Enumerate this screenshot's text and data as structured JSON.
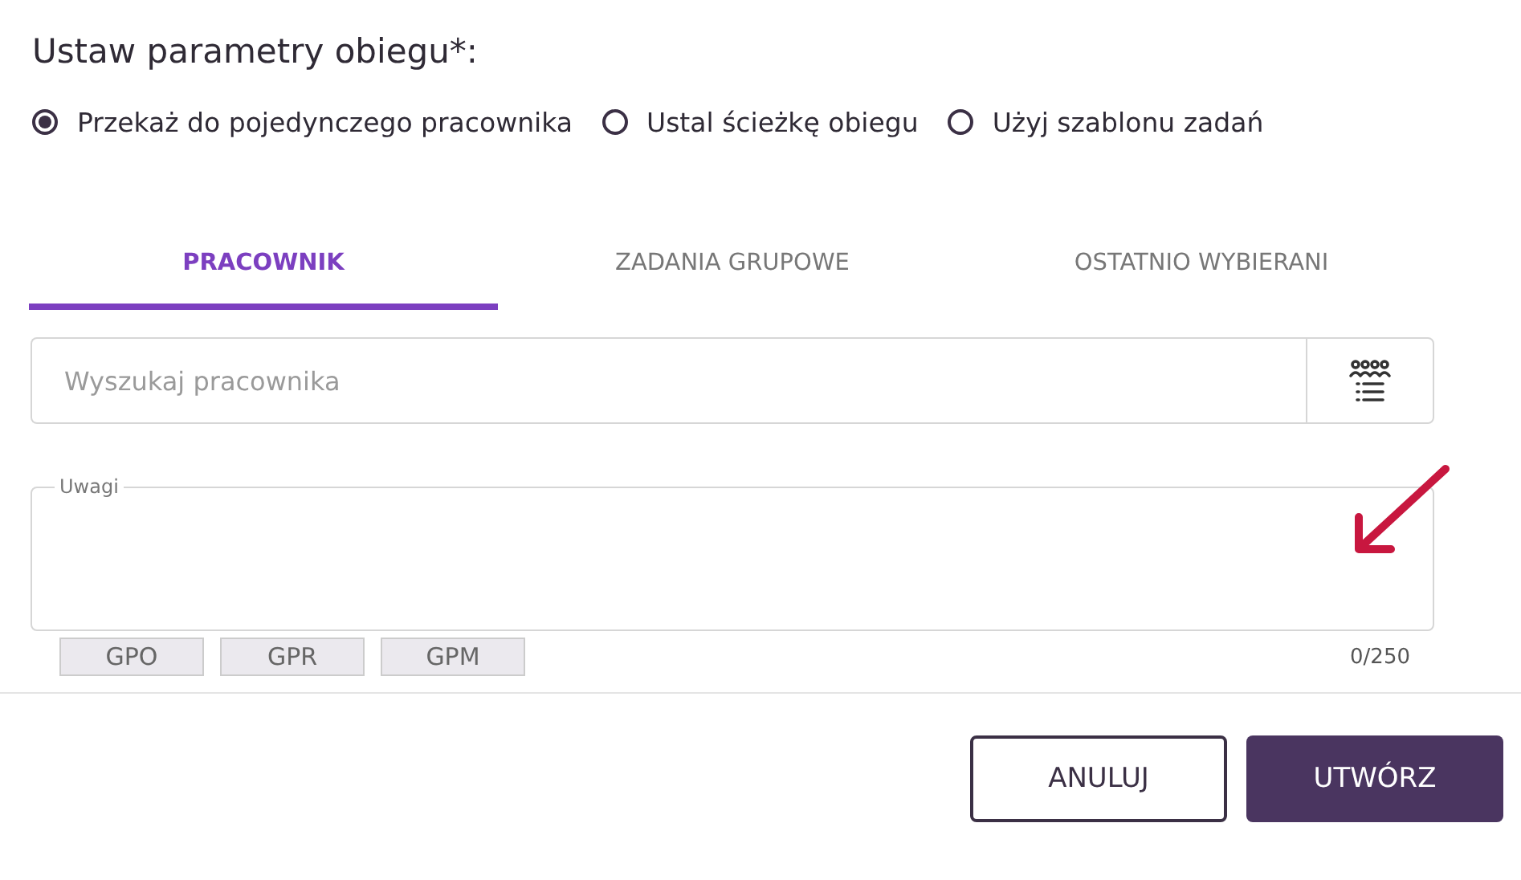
{
  "heading": "Ustaw parametry obiegu*:",
  "options": [
    {
      "label": "Przekaż do pojedynczego pracownika",
      "selected": true
    },
    {
      "label": "Ustal ścieżkę obiegu",
      "selected": false
    },
    {
      "label": "Użyj szablonu zadań",
      "selected": false
    }
  ],
  "tabs": [
    {
      "label": "PRACOWNIK",
      "selected": true
    },
    {
      "label": "ZADANIA GRUPOWE",
      "selected": false
    },
    {
      "label": "OSTATNIO WYBIERANI",
      "selected": false
    }
  ],
  "search": {
    "placeholder": "Wyszukaj pracownika"
  },
  "remarks": {
    "label": "Uwagi",
    "counter": "0/250"
  },
  "chips": [
    "GPO",
    "GPR",
    "GPM"
  ],
  "buttons": [
    {
      "label": "ANULUJ",
      "kind": "secondary"
    },
    {
      "label": "UTWÓRZ",
      "kind": "primary"
    }
  ]
}
